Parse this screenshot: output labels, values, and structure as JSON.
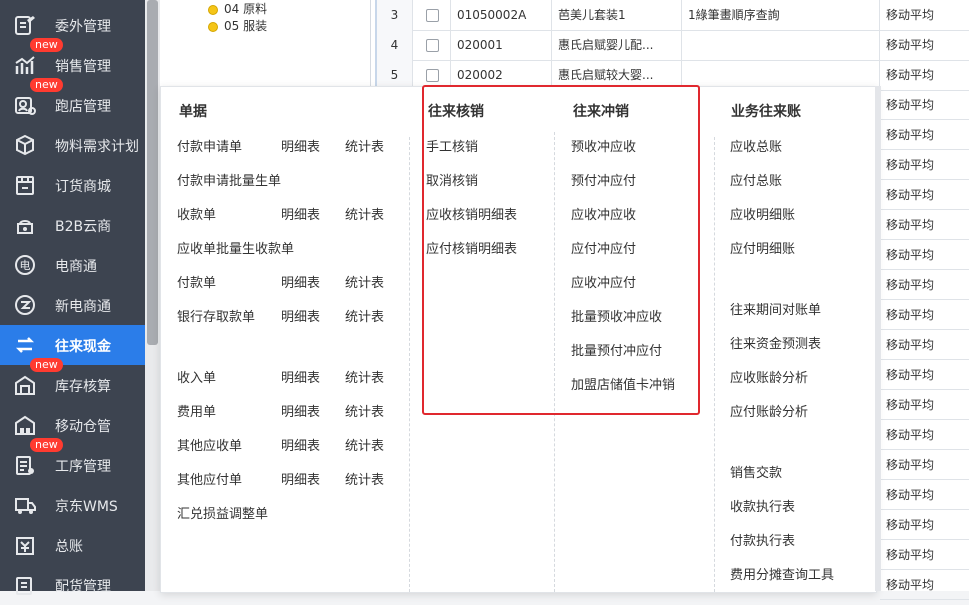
{
  "sidebar": {
    "items": [
      {
        "label": "委外管理",
        "icon": "outsourcing-icon",
        "badge": ""
      },
      {
        "label": "销售管理",
        "icon": "sales-chart-icon",
        "badge": "new"
      },
      {
        "label": "跑店管理",
        "icon": "store-visit-icon",
        "badge": "new"
      },
      {
        "label": "物料需求计划",
        "icon": "material-box-icon",
        "badge": ""
      },
      {
        "label": "订货商城",
        "icon": "mall-icon",
        "badge": ""
      },
      {
        "label": "B2B云商",
        "icon": "b2b-cloud-icon",
        "badge": ""
      },
      {
        "label": "电商通",
        "icon": "ecommerce-icon",
        "badge": ""
      },
      {
        "label": "新电商通",
        "icon": "new-ecommerce-icon",
        "badge": ""
      },
      {
        "label": "往来现金",
        "icon": "exchange-arrows-icon",
        "badge": ""
      },
      {
        "label": "库存核算",
        "icon": "inventory-icon",
        "badge": "new"
      },
      {
        "label": "移动仓管",
        "icon": "mobile-warehouse-icon",
        "badge": ""
      },
      {
        "label": "工序管理",
        "icon": "process-icon",
        "badge": "new"
      },
      {
        "label": "京东WMS",
        "icon": "truck-icon",
        "badge": ""
      },
      {
        "label": "总账",
        "icon": "ledger-icon",
        "badge": ""
      },
      {
        "label": "配货管理",
        "icon": "distribution-icon",
        "badge": ""
      }
    ]
  },
  "tree": {
    "nodes": [
      "04 原料",
      "05 服装"
    ]
  },
  "table": {
    "rows": [
      {
        "num": "3",
        "code": "01050002A",
        "name": "芭美儿套装1",
        "spec": "1綠筆畫順序查詢",
        "method": "移动平均"
      },
      {
        "num": "4",
        "code": "020001",
        "name": "惠氏启赋婴儿配...",
        "spec": "",
        "method": "移动平均"
      },
      {
        "num": "5",
        "code": "020002",
        "name": "惠氏启赋较大婴...",
        "spec": "",
        "method": "移动平均"
      }
    ],
    "extra_method": "移动平均"
  },
  "menu": {
    "col1": {
      "title": "单据",
      "rows": [
        {
          "main": "付款申请单",
          "detail": "明细表",
          "stats": "统计表"
        },
        {
          "main": "付款申请批量生单",
          "detail": "",
          "stats": ""
        },
        {
          "main": "收款单",
          "detail": "明细表",
          "stats": "统计表"
        },
        {
          "main": "应收单批量生收款单",
          "detail": "",
          "stats": ""
        },
        {
          "main": "付款单",
          "detail": "明细表",
          "stats": "统计表"
        },
        {
          "main": "银行存取款单",
          "detail": "明细表",
          "stats": "统计表"
        },
        {
          "main": "收入单",
          "detail": "明细表",
          "stats": "统计表"
        },
        {
          "main": "费用单",
          "detail": "明细表",
          "stats": "统计表"
        },
        {
          "main": "其他应收单",
          "detail": "明细表",
          "stats": "统计表"
        },
        {
          "main": "其他应付单",
          "detail": "明细表",
          "stats": "统计表"
        },
        {
          "main": "汇兑损益调整单",
          "detail": "",
          "stats": ""
        }
      ]
    },
    "col2": {
      "title": "往来核销",
      "items": [
        "手工核销",
        "取消核销",
        "应收核销明细表",
        "应付核销明细表"
      ]
    },
    "col3": {
      "title": "往来冲销",
      "items": [
        "预收冲应收",
        "预付冲应付",
        "应收冲应收",
        "应付冲应付",
        "应收冲应付",
        "批量预收冲应收",
        "批量预付冲应付",
        "加盟店储值卡冲销"
      ]
    },
    "col4": {
      "title": "业务往来账",
      "items": [
        "应收总账",
        "应付总账",
        "应收明细账",
        "应付明细账",
        "往来期间对账单",
        "往来资金预测表",
        "应收账龄分析",
        "应付账龄分析",
        "销售交款",
        "收款执行表",
        "付款执行表",
        "费用分摊查询工具"
      ]
    }
  },
  "colors": {
    "sidebar_bg": "#3d4450",
    "active": "#2b7de9",
    "badge": "#ff3b30",
    "highlight_border": "#e0282e"
  }
}
